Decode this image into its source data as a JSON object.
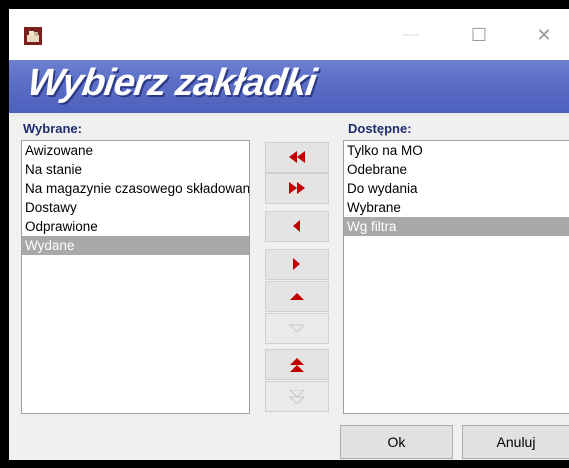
{
  "window": {
    "minimize_glyph": "—",
    "maximize_glyph": "☐",
    "close_glyph": "✕"
  },
  "header": {
    "title": "Wybierz zakładki"
  },
  "selected": {
    "label": "Wybrane:",
    "items": [
      "Awizowane",
      "Na stanie",
      "Na magazynie czasowego składowania",
      "Dostawy",
      "Odprawione",
      "Wydane"
    ],
    "selected_index": 5
  },
  "available": {
    "label": "Dostępne:",
    "items": [
      "Tylko na MO",
      "Odebrane",
      "Do wydania",
      "Wybrane",
      "Wg filtra"
    ],
    "selected_index": 4
  },
  "arrows": {
    "accent": "#c00000",
    "disabled": "#c8c8c8",
    "buttons": [
      {
        "name": "move-all-left-button",
        "icon": "double-left-icon",
        "enabled": true
      },
      {
        "name": "move-all-right-button",
        "icon": "double-right-icon",
        "enabled": true
      },
      {
        "name": "move-left-button",
        "icon": "left-icon",
        "enabled": true
      },
      {
        "name": "move-right-button",
        "icon": "right-icon",
        "enabled": true
      },
      {
        "name": "move-up-button",
        "icon": "up-icon",
        "enabled": true
      },
      {
        "name": "move-down-button",
        "icon": "down-icon",
        "enabled": false
      },
      {
        "name": "move-top-button",
        "icon": "double-up-icon",
        "enabled": true
      },
      {
        "name": "move-bottom-button",
        "icon": "double-down-icon",
        "enabled": false
      }
    ]
  },
  "footer": {
    "ok_label": "Ok",
    "cancel_label": "Anuluj"
  }
}
